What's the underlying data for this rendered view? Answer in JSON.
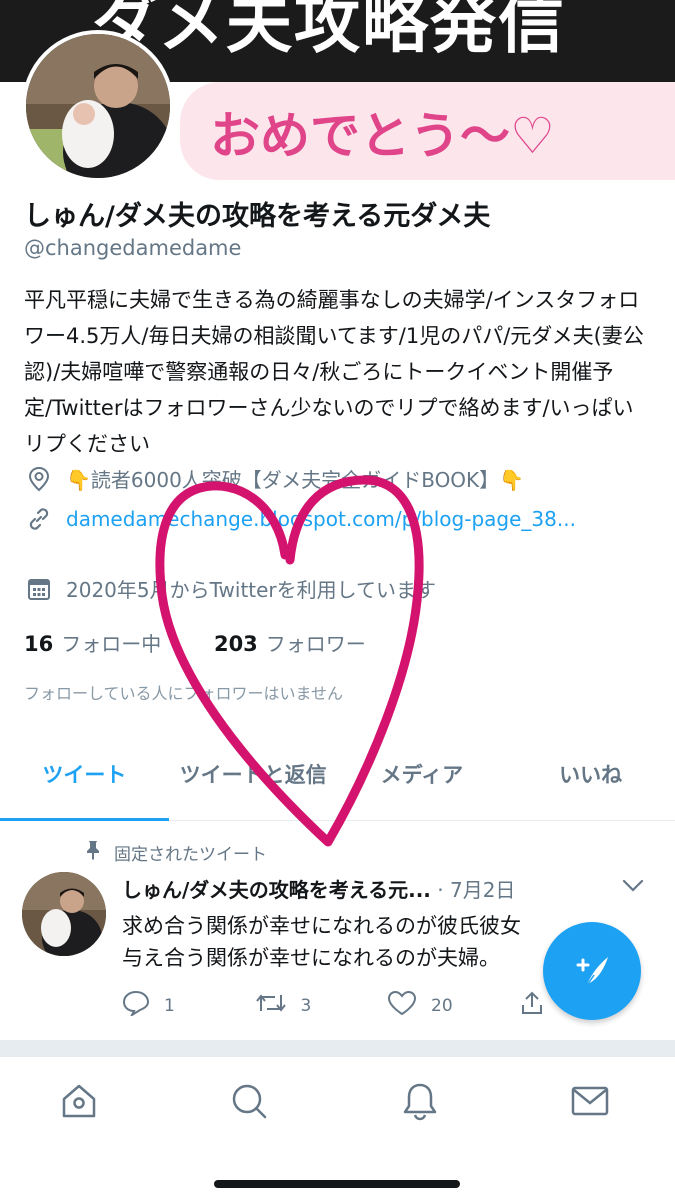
{
  "banner": {
    "title": "ダメ夫攻略発信"
  },
  "overlay": {
    "speech_text": "おめでとう〜♡"
  },
  "profile": {
    "display_name": "しゅん/ダメ夫の攻略を考える元ダメ夫",
    "handle": "@changedamedame",
    "bio": "平凡平穏に夫婦で生きる為の綺麗事なしの夫婦学/インスタフォロワー4.5万人/毎日夫婦の相談聞いてます/1児のパパ/元ダメ夫(妻公認)/夫婦喧嘩で警察通報の日々/秋ごろにトークイベント開催予定/Twitterはフォロワーさん少ないのでリプで絡めます/いっぱいリプください",
    "location": "👇読者6000人突破【ダメ夫完全ガイドBOOK】👇",
    "link": "damedamechange.blogspot.com/p/blog-page_38...",
    "joined": "2020年5月からTwitterを利用しています",
    "following_count": "16",
    "following_label": "フォロー中",
    "followers_count": "203",
    "followers_label": "フォロワー",
    "not_followed_note": "フォローしている人にフォロワーはいません"
  },
  "tabs": [
    {
      "label": "ツイート"
    },
    {
      "label": "ツイートと返信"
    },
    {
      "label": "メディア"
    },
    {
      "label": "いいね"
    }
  ],
  "pinned_tweet": {
    "pinned_label": "固定されたツイート",
    "author": "しゅん/ダメ夫の攻略を考える元...",
    "date": "· 7月2日",
    "line1": "求め合う関係が幸せになれるのが彼氏彼女",
    "line2": "与え合う関係が幸せになれるのが夫婦。",
    "replies": "1",
    "retweets": "3",
    "likes": "20"
  },
  "colors": {
    "accent": "#1da1f2",
    "heart_overlay": "#d4136e",
    "speech_text": "#e0458a",
    "speech_bg": "#fde5ec",
    "banner_bg": "#1b1b1b"
  }
}
